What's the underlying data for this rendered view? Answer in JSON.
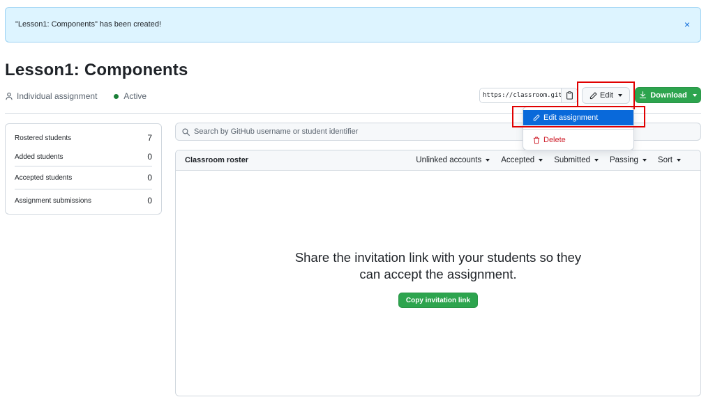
{
  "flash": {
    "message": "\"Lesson1: Components\" has been created!",
    "close_icon": "×"
  },
  "assignment": {
    "title": "Lesson1: Components",
    "type_label": "Individual assignment",
    "status_label": "Active",
    "invite_url": "https://classroom.github.com/a/..."
  },
  "toolbar": {
    "edit_label": "Edit",
    "download_label": "Download"
  },
  "edit_menu": {
    "edit_assignment": "Edit assignment",
    "delete": "Delete"
  },
  "stats": [
    {
      "label": "Rostered students",
      "value": "7"
    },
    {
      "label": "Added students",
      "value": "0"
    },
    {
      "label": "Accepted students",
      "value": "0"
    },
    {
      "label": "Assignment submissions",
      "value": "0"
    }
  ],
  "search": {
    "placeholder": "Search by GitHub username or student identifier"
  },
  "roster": {
    "title": "Classroom roster",
    "filters": [
      "Unlinked accounts",
      "Accepted",
      "Submitted",
      "Passing",
      "Sort"
    ]
  },
  "empty_state": {
    "message": "Share the invitation link with your students so they can accept the assignment.",
    "copy_button": "Copy invitation link"
  },
  "colors": {
    "accent": "#0969da",
    "success": "#2da44e",
    "danger": "#cf222e",
    "highlight": "#e00000",
    "flash_bg": "#ddf4ff"
  }
}
